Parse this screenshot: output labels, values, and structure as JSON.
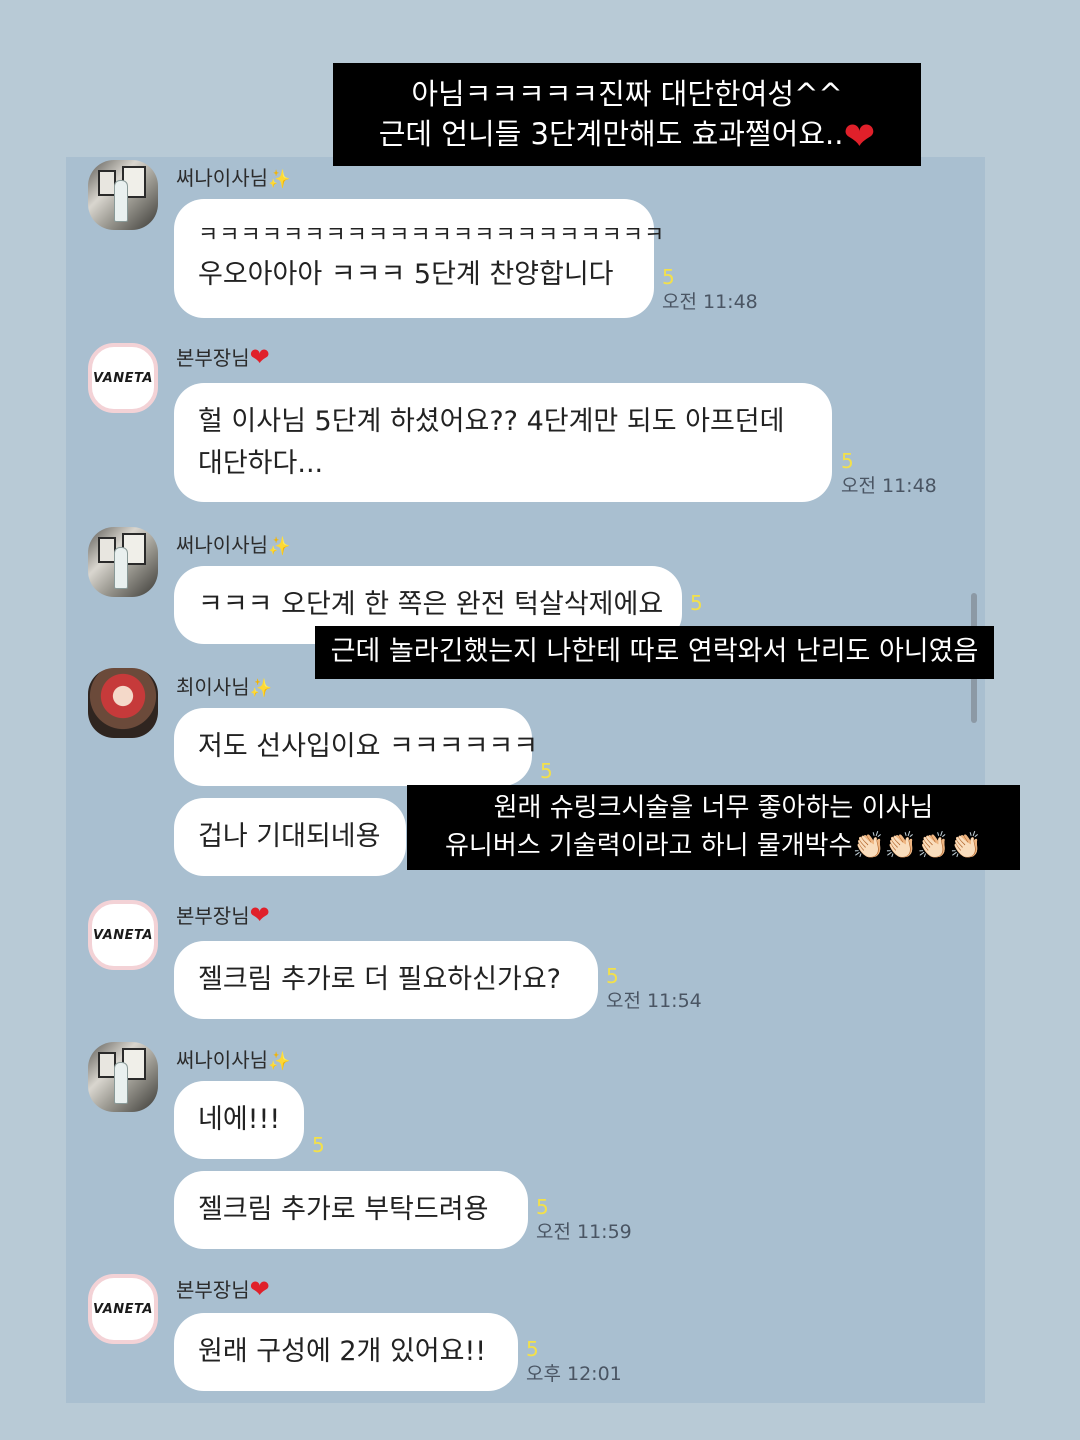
{
  "captions": {
    "top_line1": "아님ㅋㅋㅋㅋㅋ진짜 대단한여성^^",
    "top_line2": "근데 언니들 3단계만해도 효과쩔어요..",
    "middle": "근데 놀라긴했는지 나한테 따로 연락와서 난리도 아니였음",
    "lower_line1": "원래 슈링크시술을 너무 좋아하는 이사님",
    "lower_line2": "유니버스 기술력이라고 하니 물개박수👏🏻👏🏻👏🏻👏🏻"
  },
  "senders": {
    "a": "써나이사님",
    "b": "본부장님",
    "c": "최이사님",
    "logo_text": "VANETA"
  },
  "messages": [
    {
      "line1": "ㅋㅋㅋㅋㅋㅋㅋㅋㅋㅋㅋㅋㅋㅋㅋㅋㅋㅋㅋㅋㅋㅋ",
      "line2": "우오아아아 ㅋㅋㅋ  5단계 찬양합니다",
      "count": "5",
      "time": "오전 11:48"
    },
    {
      "line1": "헐 이사님 5단계 하셨어요?? 4단계만 되도 아프던데",
      "line2": "대단하다...",
      "count": "5",
      "time": "오전 11:48"
    },
    {
      "text": "ㅋㅋㅋ 오단계 한 쪽은 완전 턱살삭제에요",
      "count": "5"
    },
    {
      "text": "저도 선사입이요 ㅋㅋㅋㅋㅋㅋ",
      "count": "5"
    },
    {
      "text": "겁나 기대되네용"
    },
    {
      "text": "젤크림 추가로 더 필요하신가요?",
      "count": "5",
      "time": "오전 11:54"
    },
    {
      "text": "네에!!!",
      "count": "5"
    },
    {
      "text": "젤크림 추가로  부탁드려용",
      "count": "5",
      "time": "오전 11:59"
    },
    {
      "text": "원래 구성에 2개 있어요!!",
      "count": "5",
      "time": "오후 12:01"
    }
  ]
}
